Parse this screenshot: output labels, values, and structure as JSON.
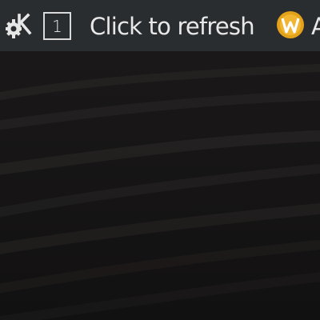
{
  "colors": {
    "taskbar_bg": "#2a2d30",
    "text": "#e8e8e8",
    "desktop_bg": "#171515",
    "tray_icon_accent": "#e3a21a"
  },
  "taskbar": {
    "launcher_icon": "kde-gear-icon",
    "pager": {
      "current_desktop": "1"
    },
    "refresh_label": "Click to refresh",
    "tray_app": {
      "icon": "w-circle-icon",
      "label": "A"
    }
  }
}
